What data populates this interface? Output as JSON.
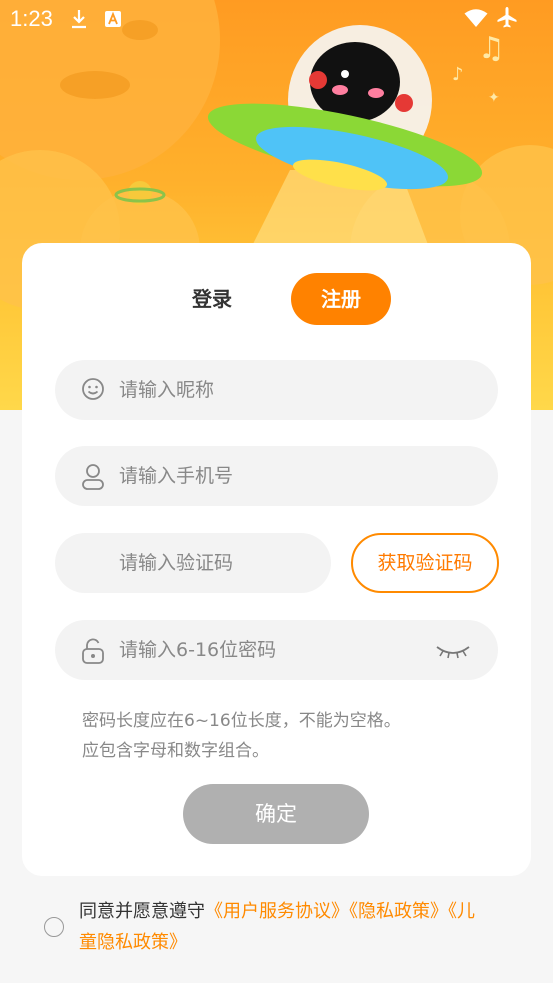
{
  "status_bar": {
    "time": "1:23"
  },
  "tabs": {
    "login": "登录",
    "register": "注册"
  },
  "form": {
    "nickname_placeholder": "请输入昵称",
    "phone_placeholder": "请输入手机号",
    "code_placeholder": "请输入验证码",
    "get_code_label": "获取验证码",
    "password_placeholder": "请输入6-16位密码"
  },
  "hint": {
    "line1": "密码长度应在6~16位长度，不能为空格。",
    "line2": "应包含字母和数字组合。"
  },
  "confirm_label": "确定",
  "agreement": {
    "prefix": "同意并愿意遵守",
    "user_agreement": "《用户服务协议》",
    "privacy_policy": "《隐私政策》",
    "child_privacy_line1": "《儿",
    "child_privacy_line2": "童隐私政策》"
  },
  "icons": [
    "download-icon",
    "a-icon",
    "wifi-icon",
    "airplane-icon",
    "smiley-icon",
    "user-icon",
    "lock-icon",
    "eye-closed-icon",
    "music-note-icon",
    "ufo-robot-illustration",
    "planet-icon"
  ],
  "colors": {
    "accent": "#ff8200",
    "disabled": "#b0b0b0"
  }
}
